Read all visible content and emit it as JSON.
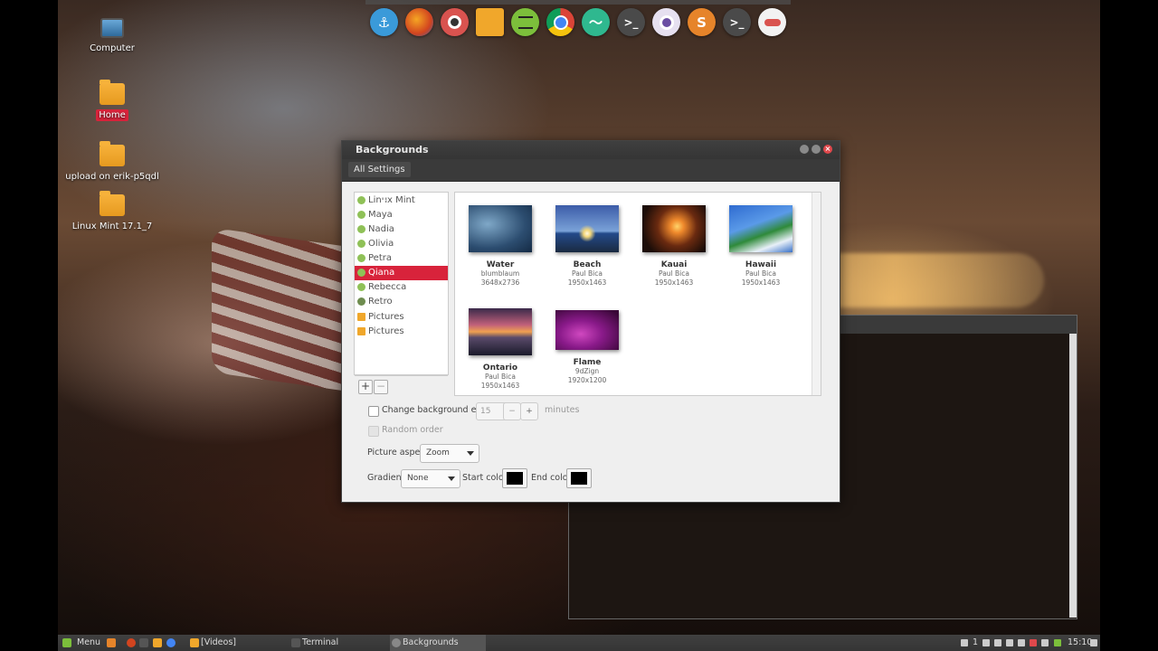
{
  "desktop": {
    "icons": [
      {
        "label": "Computer",
        "icon": "computer-icon"
      },
      {
        "label": "Home",
        "icon": "home-folder-icon"
      },
      {
        "label": "upload on erik-p5qdl",
        "icon": "network-folder-icon"
      },
      {
        "label": "Linux Mint 17.1_7",
        "icon": "folder-icon"
      }
    ]
  },
  "dock": {
    "icons": [
      "anchor-icon",
      "firefox-icon",
      "obs-icon",
      "files-icon",
      "spotify-icon",
      "chrome-icon",
      "system-monitor-icon",
      "terminal-icon",
      "webcam-icon",
      "sublime-text-icon",
      "terminal-icon",
      "settings-toggle-icon"
    ],
    "glyphs": [
      "⚓",
      "",
      "",
      "",
      "",
      "",
      "〜",
      ">_",
      "",
      "S",
      ">_",
      ""
    ]
  },
  "window": {
    "title": "Backgrounds",
    "all_settings": "All Settings",
    "collections": [
      {
        "label": "Linux Mint",
        "type": "mint"
      },
      {
        "label": "Maya",
        "type": "mint"
      },
      {
        "label": "Nadia",
        "type": "mint"
      },
      {
        "label": "Olivia",
        "type": "mint"
      },
      {
        "label": "Petra",
        "type": "mint"
      },
      {
        "label": "Qiana",
        "type": "mint",
        "selected": true
      },
      {
        "label": "Rebecca",
        "type": "mint"
      },
      {
        "label": "Retro",
        "type": "retro"
      },
      {
        "label": "Pictures",
        "type": "folder"
      },
      {
        "label": "Pictures",
        "type": "folder"
      }
    ],
    "add_label": "+",
    "remove_label": "−",
    "wallpapers": [
      {
        "name": "Water",
        "author": "blumblaum",
        "size": "3648x2736"
      },
      {
        "name": "Beach",
        "author": "Paul Bica",
        "size": "1950x1463"
      },
      {
        "name": "Kauai",
        "author": "Paul Bica",
        "size": "1950x1463"
      },
      {
        "name": "Hawaii",
        "author": "Paul Bica",
        "size": "1950x1463"
      },
      {
        "name": "Ontario",
        "author": "Paul Bica",
        "size": "1950x1463"
      },
      {
        "name": "Flame",
        "author": "9dZign",
        "size": "1920x1200"
      }
    ],
    "change_every_label": "Change background every",
    "change_every_value": "15",
    "minutes_label": "minutes",
    "random_order_label": "Random order",
    "picture_aspect_label": "Picture aspect",
    "picture_aspect_value": "Zoom",
    "gradient_label": "Gradient",
    "gradient_value": "None",
    "start_color_label": "Start color",
    "end_color_label": "End color",
    "start_color": "#000000",
    "end_color": "#000000"
  },
  "taskbar": {
    "menu_label": "Menu",
    "items": [
      "[Videos]",
      "Terminal",
      "Backgrounds"
    ],
    "workspace": "1",
    "clock": "15:10"
  }
}
